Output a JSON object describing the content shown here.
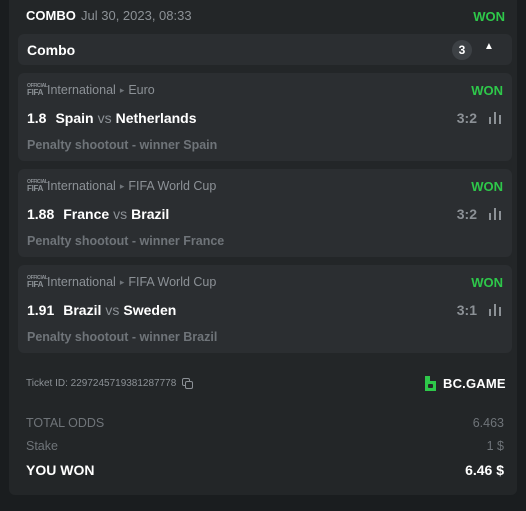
{
  "header": {
    "type": "COMBO",
    "date": "Jul 30, 2023, 08:33",
    "status": "WON"
  },
  "combo": {
    "title": "Combo",
    "count": "3"
  },
  "bets": [
    {
      "league_icon": "fifa-icon",
      "category": "International",
      "tournament": "Euro",
      "status": "WON",
      "odds": "1.8",
      "home": "Spain",
      "vs": "vs",
      "away": "Netherlands",
      "score": "3:2",
      "description": "Penalty shootout - winner Spain"
    },
    {
      "league_icon": "fifa-icon",
      "category": "International",
      "tournament": "FIFA World Cup",
      "status": "WON",
      "odds": "1.88",
      "home": "France",
      "vs": "vs",
      "away": "Brazil",
      "score": "3:2",
      "description": "Penalty shootout - winner France"
    },
    {
      "league_icon": "fifa-icon",
      "category": "International",
      "tournament": "FIFA World Cup",
      "status": "WON",
      "odds": "1.91",
      "home": "Brazil",
      "vs": "vs",
      "away": "Sweden",
      "score": "3:1",
      "description": "Penalty shootout - winner Brazil"
    }
  ],
  "ticket": {
    "label": "Ticket ID: 2297245719381287778"
  },
  "brand": {
    "name": "BC.GAME",
    "color": "#2ec84a"
  },
  "summary": {
    "total_odds_label": "TOTAL ODDS",
    "total_odds": "6.463",
    "stake_label": "Stake",
    "stake": "1 $",
    "won_label": "YOU WON",
    "won": "6.46 $"
  },
  "colors": {
    "won": "#2ec84a",
    "background": "#1a1d1f",
    "card": "#232628",
    "panel": "#2b2e31"
  }
}
